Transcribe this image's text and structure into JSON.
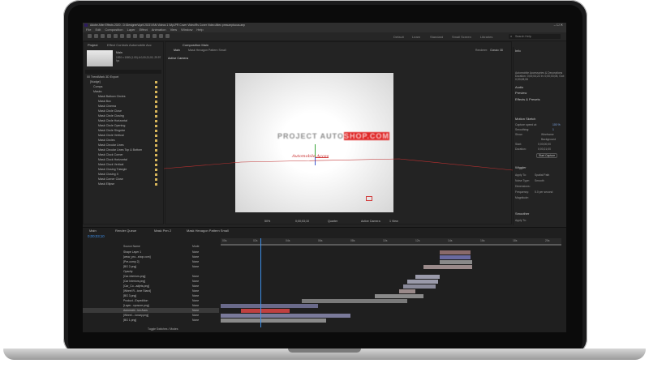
{
  "app": {
    "title": "Adobe After Effects 2020 - D:\\Designer\\April 2021\\YAN Videos 1 \\MyLPR Cover Video\\Rs Cover Video Aftec presumptuous.aep",
    "menu": [
      "File",
      "Edit",
      "Composition",
      "Layer",
      "Effect",
      "Animation",
      "View",
      "Window",
      "Help"
    ],
    "workspaces": [
      "Default",
      "Learn",
      "Standard",
      "Small Screen",
      "Libraries"
    ],
    "search_placeholder": "Search Help"
  },
  "project_panel": {
    "tab_project": "Project",
    "tab_effect": "Effect Controls Automobile Acc",
    "comp_name": "Main",
    "comp_info": "1920 x 1080 (1.00) Δ 0;00;21;00, 29.97 fps",
    "items": [
      "00 TrendMark 3D Export",
      "[Nudge]",
      "Comps",
      "Masks",
      "Mask Balloon Circles",
      "Mask Box",
      "Mask Cinema",
      "Mask Circle Close",
      "Mask Circle Closing",
      "Mask Circle Horizontal",
      "Mask Circle Opening",
      "Mask Circle Singular",
      "Mask Circle Vertical",
      "Mask Circles",
      "Mask Circular Lines",
      "Mask Circular Lines Top & Bottom",
      "Mask Clock Corner",
      "Mask Clock Horizontal",
      "Mask Clock Vertical",
      "Mask Closing Triangle",
      "Mask Closing X",
      "Mask Corner Close",
      "Mask Ellipse"
    ]
  },
  "composition": {
    "tab": "Composition Main",
    "subtab_main": "Main",
    "subtab_other": "Mask Hexagon Pattern Small",
    "camera_label": "Active Camera",
    "renderer": "Renderer:",
    "renderer_value": "Classic 3D",
    "logo_text_grey": "PROJECT AUTO",
    "logo_text_red": "SHOP.COM",
    "script_text": "Automobile Acces",
    "zoom": "50%",
    "time": "0;00;03;10",
    "resolution": "Quarter",
    "camera": "Active Camera",
    "views": "1 View"
  },
  "right_panel": {
    "info": "Info",
    "info_text": "Automobile Accessories & Decorations\nDuration: 0;00;04;22\nIn: 0;00;03;05, Out: 0;00;08;06",
    "audio": "Audio",
    "preview": "Preview",
    "effects": "Effects & Presets",
    "motion_sketch": "Motion Sketch",
    "capture_speed": "Capture speed at:",
    "capture_value": "100 %",
    "smoothing": "Smoothing:",
    "smoothing_value": "1",
    "show": "Show:",
    "wireframe": "Wireframe",
    "background": "Background",
    "start": "Start:",
    "start_value": "0;00;00;00",
    "duration": "Duration:",
    "duration_value": "0;00;21;00",
    "start_capture": "Start Capture",
    "wiggler": "Wiggler",
    "apply_to": "Apply To:",
    "apply_value": "Spatial Path",
    "noise_type": "Noise Type:",
    "noise_value": "Smooth",
    "dimensions": "Dimensions:",
    "frequency": "Frequency:",
    "frequency_value": "5.0 per second",
    "magnitude": "Magnitude:",
    "smoother": "Smoother",
    "apply_to2": "Apply To:"
  },
  "timeline": {
    "tabs": [
      "Main",
      "Render Queue",
      "Mask Pen 2",
      "Mask Hexagon Pattern Small"
    ],
    "timecode": "0;00;03;10",
    "source_name": "Source Name",
    "mode": "Mode",
    "toggle_label": "Toggle Switches / Modes",
    "ticks": [
      "00s",
      "02s",
      "04s",
      "06s",
      "08s",
      "10s",
      "12s",
      "14s",
      "16s",
      "18s",
      "20s"
    ],
    "layers": [
      {
        "num": "1",
        "name": "Shape Layer 1",
        "mode": "None"
      },
      {
        "num": "2",
        "name": "[www_pro...shop.com]",
        "mode": "None"
      },
      {
        "num": "3",
        "name": "[Pre-comp 2]",
        "mode": "None"
      },
      {
        "num": "4",
        "name": "[BG 2.png]",
        "mode": "None"
      },
      {
        "num": "5",
        "name": "Opacity",
        "mode": ""
      },
      {
        "num": "6",
        "name": "[Car-Interiors.png]",
        "mode": "None"
      },
      {
        "num": "7",
        "name": "[Car Interiors.png]",
        "mode": "None"
      },
      {
        "num": "8",
        "name": "[Car_Co...adjets.png]",
        "mode": "None"
      },
      {
        "num": "9",
        "name": "[Wheel R...tone Stand]",
        "mode": "None"
      },
      {
        "num": "10",
        "name": "[BG 3.png]",
        "mode": "None"
      },
      {
        "num": "11",
        "name": "Product...Expedition",
        "mode": "None"
      },
      {
        "num": "12",
        "name": "[Layer...xposure.png]",
        "mode": "None"
      },
      {
        "num": "13",
        "name": "Automobi...ion Accs",
        "mode": "None"
      },
      {
        "num": "14",
        "name": "[Wheel....Ionary.png]",
        "mode": "None"
      },
      {
        "num": "15",
        "name": "[BG 1.png]",
        "mode": "None"
      }
    ]
  },
  "colors": {
    "accent_blue": "#3c8ee8",
    "brand_red": "#e02828",
    "ui_dark": "#232323"
  }
}
